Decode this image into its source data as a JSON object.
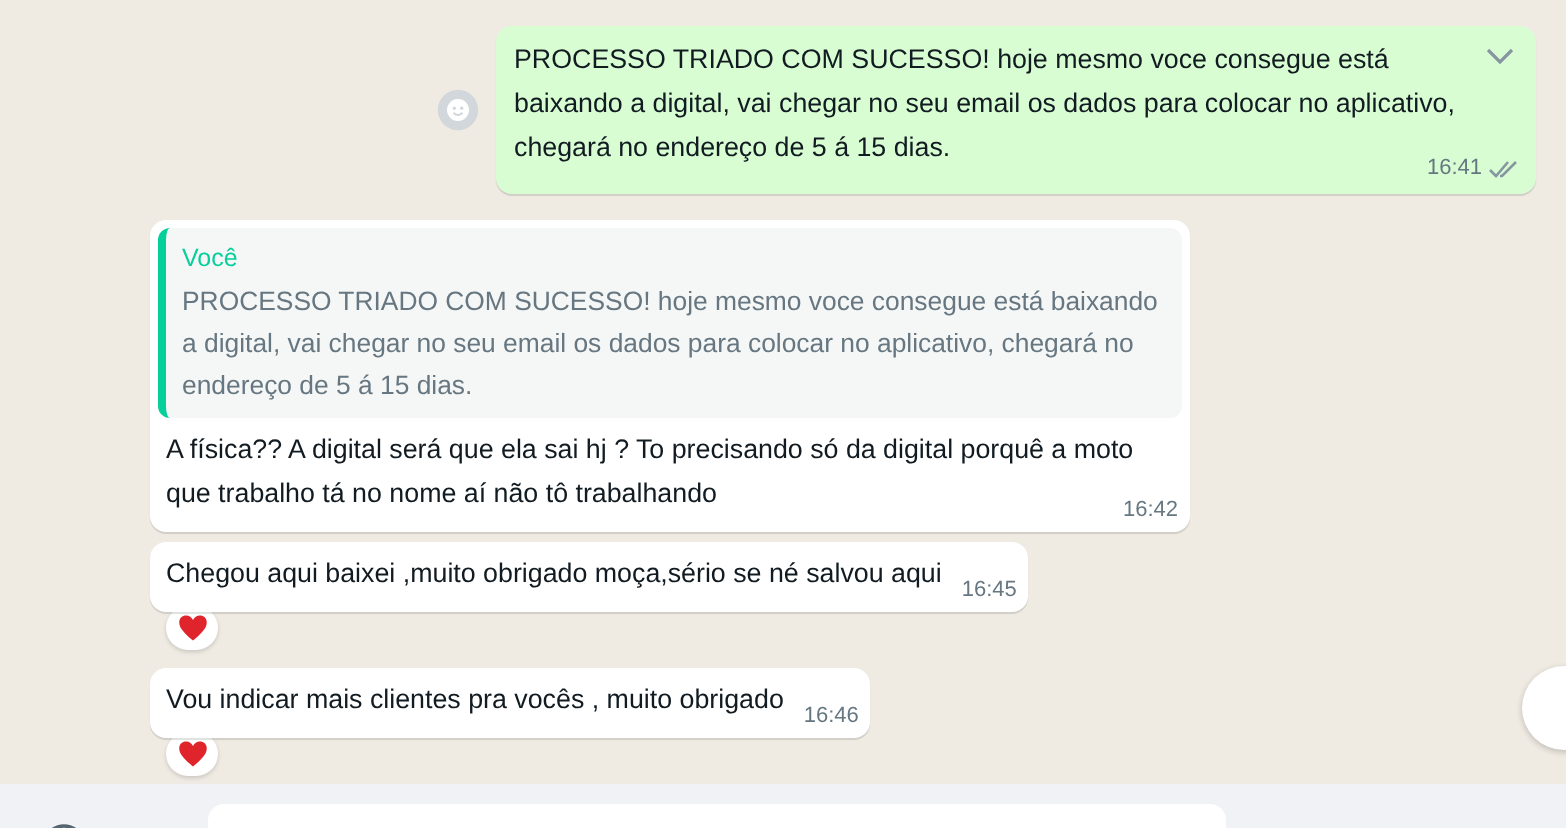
{
  "messages": [
    {
      "kind": "out",
      "text": "PROCESSO TRIADO COM SUCESSO! hoje mesmo voce consegue está baixando a digital, vai chegar no seu email os dados para colocar no aplicativo, chegará no endereço de 5 á 15 dias.",
      "time": "16:41",
      "read": false
    },
    {
      "kind": "in",
      "quote": {
        "author": "Você",
        "text": "PROCESSO TRIADO COM SUCESSO! hoje mesmo voce consegue está baixando a digital, vai chegar no seu email os dados para colocar no aplicativo, chegará no endereço de 5 á 15 dias."
      },
      "text": "A física?? A digital será que ela sai hj ? To precisando só da digital porquê a moto que trabalho tá no nome aí não tô trabalhando",
      "time": "16:42",
      "reacted": false
    },
    {
      "kind": "in",
      "text": "Chegou aqui baixei ,muito obrigado moça,sério se né salvou aqui",
      "time": "16:45",
      "reacted": true
    },
    {
      "kind": "in",
      "text": "Vou indicar mais clientes pra vocês , muito obrigado",
      "time": "16:46",
      "reacted": true
    }
  ]
}
